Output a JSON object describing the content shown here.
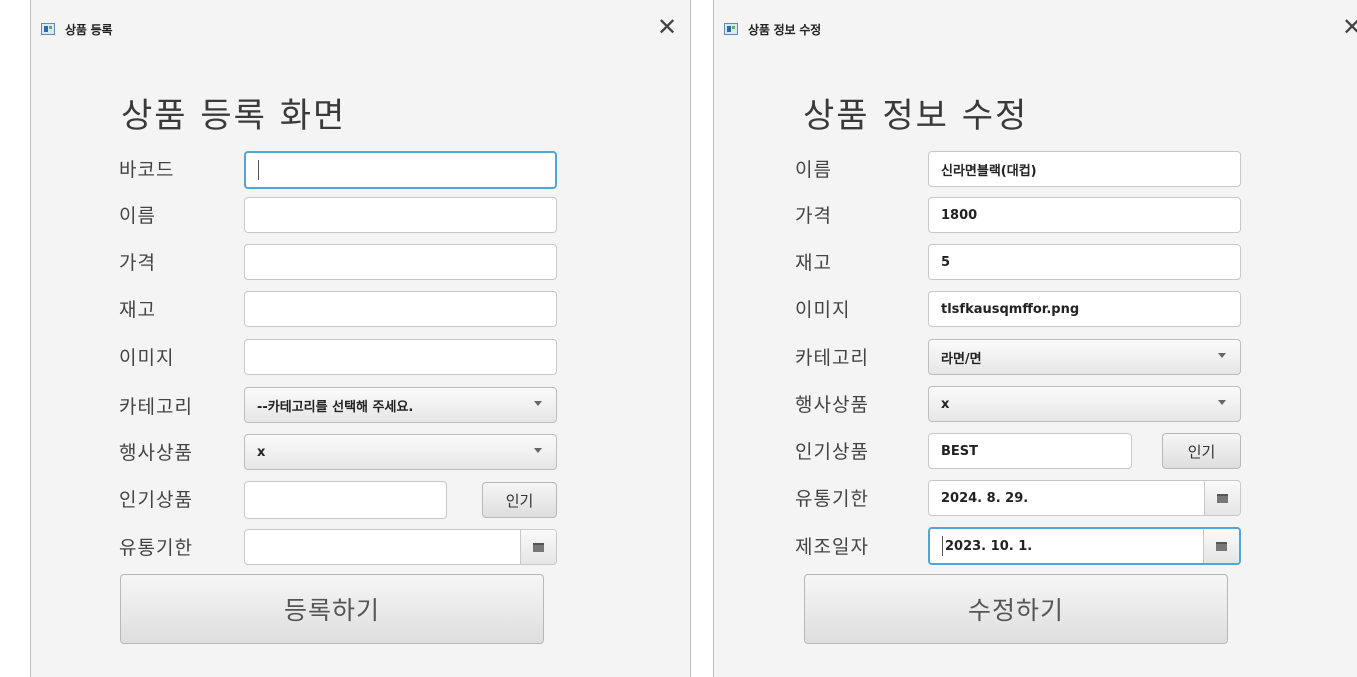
{
  "register": {
    "window_title": "상품 등록",
    "heading": "상품 등록 화면",
    "labels": {
      "barcode": "바코드",
      "name": "이름",
      "price": "가격",
      "stock": "재고",
      "image": "이미지",
      "category": "카테고리",
      "event": "행사상품",
      "popular": "인기상품",
      "expiry": "유통기한"
    },
    "category_selected": "--카테고리를 선택해 주세요.",
    "event_selected": "x",
    "popular_button": "인기",
    "submit_button": "등록하기"
  },
  "edit": {
    "window_title": "상품 정보 수정",
    "heading": "상품 정보 수정",
    "labels": {
      "name": "이름",
      "price": "가격",
      "stock": "재고",
      "image": "이미지",
      "category": "카테고리",
      "event": "행사상품",
      "popular": "인기상품",
      "expiry": "유통기한",
      "manufacture": "제조일자"
    },
    "values": {
      "name": "신라면블랙(대컵)",
      "price": "1800",
      "stock": "5",
      "image": "tlsfkausqmffor.png",
      "category": "라면/면",
      "event": "x",
      "popular": "BEST",
      "expiry": "2024. 8. 29.",
      "manufacture": "2023. 10. 1."
    },
    "popular_button": "인기",
    "submit_button": "수정하기"
  },
  "icons": {
    "close": "close-icon",
    "calendar": "calendar-icon",
    "dropdown": "chevron-down-icon",
    "app": "app-window-icon"
  },
  "colors": {
    "focus": "#4ea6d9",
    "background": "#f4f4f4"
  }
}
